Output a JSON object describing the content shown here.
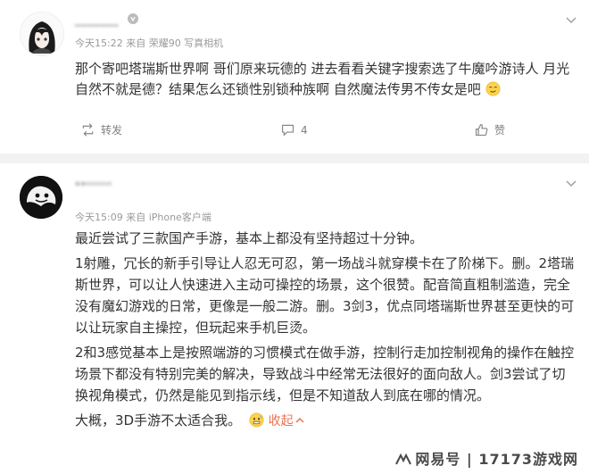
{
  "comment1": {
    "username": "_______",
    "meta": "今天15:22  来自 荣耀90 写真相机",
    "body": "那个寄吧塔瑞斯世界啊 哥们原来玩德的 进去看看关键字搜索选了牛魔吟游诗人 月光自然不就是德？结果怎么还锁性别锁种族啊 自然魔法传男不传女是吧",
    "actions": {
      "repost": "转发",
      "comment_count": "4",
      "like": "赞"
    }
  },
  "comment2": {
    "username": "\"\"'''''''",
    "meta": "今天15:09  来自 iPhone客户端",
    "paragraphs": [
      "最近尝试了三款国产手游，基本上都没有坚持超过十分钟。",
      "1射雕，冗长的新手引导让人忍无可忍，第一场战斗就穿模卡在了阶梯下。删。2塔瑞斯世界，可以让人快速进入主动可操控的场景，这个很赞。配音简直粗制滥造，完全没有魔幻游戏的日常，更像是一般二游。删。3剑3，优点同塔瑞斯世界甚至更快的可以让玩家自主操控，但玩起来手机巨烫。",
      "2和3感觉基本上是按照端游的习惯模式在做手游，控制行走加控制视角的操作在触控场景下都没有特别完美的解决，导致战斗中经常无法很好的面向敌人。剑3尝试了切换视角模式，仍然是能见到指示线，但是不知道敌人到底在哪的情况。"
    ],
    "last_line": "大概，3D手游不太适合我。",
    "collapse_label": "收起"
  },
  "watermark": "网易号 | 17173游戏网",
  "colors": {
    "accent": "#eb7350",
    "meta": "#9a9a9a",
    "text": "#333333",
    "divider": "#f1f2f4"
  }
}
